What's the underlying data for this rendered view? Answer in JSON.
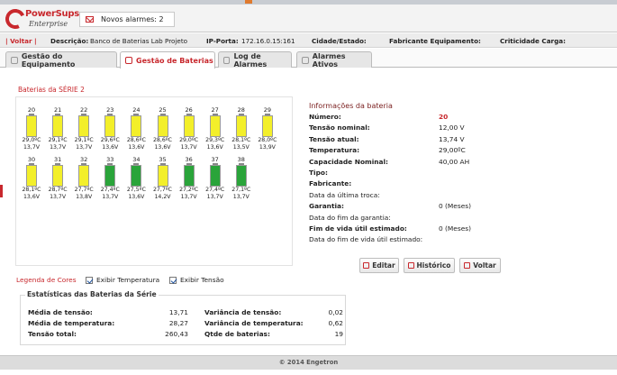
{
  "brand": {
    "name": "PowerSups",
    "sub": "Enterprise"
  },
  "alerts": {
    "label": "Novos alarmes: 2"
  },
  "infobar": {
    "voltar": "| Voltar |",
    "descricao_label": "Descrição:",
    "descricao_value": "Banco de Baterias Lab Projeto",
    "ip_label": "IP-Porta:",
    "ip_value": "172.16.0.15:161",
    "cidade_label": "Cidade/Estado:",
    "fabricante_label": "Fabricante Equipamento:",
    "criticidade_label": "Criticidade Carga:"
  },
  "tabs": [
    {
      "label": "Gestão do Equipamento",
      "active": false
    },
    {
      "label": "Gestão de Baterias",
      "active": true
    },
    {
      "label": "Log de Alarmes",
      "active": false
    },
    {
      "label": "Alarmes Ativos",
      "active": false
    }
  ],
  "serie_title": "Baterias da SÉRIE 2",
  "colors": {
    "yellow": "#f3ef2a",
    "green": "#2aa43a",
    "accent": "#c8282d"
  },
  "batteries": [
    {
      "num": "20",
      "temp": "29,0ºC",
      "volt": "13,7V",
      "color": "yellow"
    },
    {
      "num": "21",
      "temp": "29,1ºC",
      "volt": "13,7V",
      "color": "yellow"
    },
    {
      "num": "22",
      "temp": "29,1ºC",
      "volt": "13,7V",
      "color": "yellow"
    },
    {
      "num": "23",
      "temp": "29,6ºC",
      "volt": "13,6V",
      "color": "yellow"
    },
    {
      "num": "24",
      "temp": "28,6ºC",
      "volt": "13,6V",
      "color": "yellow"
    },
    {
      "num": "25",
      "temp": "28,6ºC",
      "volt": "13,6V",
      "color": "yellow"
    },
    {
      "num": "26",
      "temp": "29,0ºC",
      "volt": "13,7V",
      "color": "yellow"
    },
    {
      "num": "27",
      "temp": "29,3ºC",
      "volt": "13,6V",
      "color": "yellow"
    },
    {
      "num": "28",
      "temp": "28,1ºC",
      "volt": "13,5V",
      "color": "yellow"
    },
    {
      "num": "29",
      "temp": "28,0ºC",
      "volt": "13,9V",
      "color": "yellow"
    },
    {
      "num": "30",
      "temp": "28,1ºC",
      "volt": "13,6V",
      "color": "yellow"
    },
    {
      "num": "31",
      "temp": "28,7ºC",
      "volt": "13,7V",
      "color": "yellow"
    },
    {
      "num": "32",
      "temp": "27,7ºC",
      "volt": "13,8V",
      "color": "yellow"
    },
    {
      "num": "33",
      "temp": "27,4ºC",
      "volt": "13,7V",
      "color": "green"
    },
    {
      "num": "34",
      "temp": "27,5ºC",
      "volt": "13,6V",
      "color": "green"
    },
    {
      "num": "35",
      "temp": "27,7ºC",
      "volt": "14,2V",
      "color": "yellow"
    },
    {
      "num": "36",
      "temp": "27,2ºC",
      "volt": "13,7V",
      "color": "green"
    },
    {
      "num": "37",
      "temp": "27,4ºC",
      "volt": "13,7V",
      "color": "green"
    },
    {
      "num": "38",
      "temp": "27,1ºC",
      "volt": "13,7V",
      "color": "green"
    }
  ],
  "info": {
    "title": "Informações da bateria",
    "rows": [
      {
        "label": "Número:",
        "value": "20",
        "bold": true,
        "red": true
      },
      {
        "label": "Tensão nominal:",
        "value": "12,00 V",
        "bold": true
      },
      {
        "label": "Tensão atual:",
        "value": "13,74 V",
        "bold": true
      },
      {
        "label": "Temperatura:",
        "value": "29,00ºC",
        "bold": true
      },
      {
        "label": "Capacidade Nominal:",
        "value": "40,00 AH",
        "bold": true
      },
      {
        "label": "Tipo:",
        "value": "",
        "bold": true
      },
      {
        "label": "Fabricante:",
        "value": "",
        "bold": true
      },
      {
        "label": "Data da última troca:",
        "value": "",
        "bold": false
      },
      {
        "label": "Garantia:",
        "value": "0 (Meses)",
        "bold": true
      },
      {
        "label": "Data do fim da garantia:",
        "value": "",
        "bold": false
      },
      {
        "label": "Fim de vida útil estimado:",
        "value": "0 (Meses)",
        "bold": true
      },
      {
        "label": "Data do fim de vida útil estimado:",
        "value": "",
        "bold": false
      }
    ]
  },
  "buttons": {
    "editar": "Editar",
    "historico": "Histórico",
    "voltar": "Voltar"
  },
  "legend": {
    "label": "Legenda de Cores",
    "temp": "Exibir Temperatura",
    "tensao": "Exibir Tensão"
  },
  "stats": {
    "title": "Estatísticas das Baterias da Série",
    "media_tensao_label": "Média de tensão:",
    "media_tensao": "13,71",
    "media_temp_label": "Média de temperatura:",
    "media_temp": "28,27",
    "tensao_total_label": "Tensão total:",
    "tensao_total": "260,43",
    "var_tensao_label": "Variância de tensão:",
    "var_tensao": "0,02",
    "var_temp_label": "Variância de temperatura:",
    "var_temp": "0,62",
    "qtde_label": "Qtde de baterias:",
    "qtde": "19"
  },
  "footer": "© 2014 Engetron"
}
